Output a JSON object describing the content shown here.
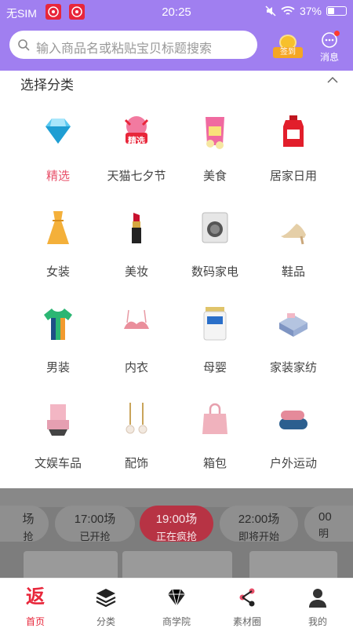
{
  "status_bar": {
    "carrier": "无SIM",
    "time": "20:25",
    "battery": "37%"
  },
  "search": {
    "placeholder": "输入商品名或粘贴宝贝标题搜索"
  },
  "header": {
    "sign_label": "签到",
    "message_label": "消息"
  },
  "panel": {
    "title": "选择分类",
    "categories": [
      {
        "label": "精选",
        "icon": "diamond-icon"
      },
      {
        "label": "天猫七夕节",
        "icon": "tmall-qixi-icon"
      },
      {
        "label": "美食",
        "icon": "snack-bag-icon"
      },
      {
        "label": "居家日用",
        "icon": "detergent-bottle-icon"
      },
      {
        "label": "女装",
        "icon": "dress-icon"
      },
      {
        "label": "美妆",
        "icon": "lipstick-icon"
      },
      {
        "label": "数码家电",
        "icon": "washing-machine-icon"
      },
      {
        "label": "鞋品",
        "icon": "heel-shoe-icon"
      },
      {
        "label": "男装",
        "icon": "tshirt-icon"
      },
      {
        "label": "内衣",
        "icon": "bra-icon"
      },
      {
        "label": "母婴",
        "icon": "milk-powder-icon"
      },
      {
        "label": "家装家纺",
        "icon": "bedding-icon"
      },
      {
        "label": "文娱车品",
        "icon": "car-seat-icon"
      },
      {
        "label": "配饰",
        "icon": "earrings-icon"
      },
      {
        "label": "箱包",
        "icon": "handbag-icon"
      },
      {
        "label": "户外运动",
        "icon": "yoga-mat-icon"
      }
    ],
    "badge_text": "精选"
  },
  "flash_sale": {
    "slots": [
      {
        "time": "场",
        "status": "抢"
      },
      {
        "time": "17:00场",
        "status": "已开抢"
      },
      {
        "time": "19:00场",
        "status": "正在疯抢"
      },
      {
        "time": "22:00场",
        "status": "即将开始"
      },
      {
        "time": "00",
        "status": "明"
      }
    ]
  },
  "tabs": [
    {
      "label": "首页",
      "icon": "fan-home-icon"
    },
    {
      "label": "分类",
      "icon": "layers-icon"
    },
    {
      "label": "商学院",
      "icon": "diamond-outline-icon"
    },
    {
      "label": "素材圈",
      "icon": "share-icon"
    },
    {
      "label": "我的",
      "icon": "user-icon"
    }
  ],
  "tab_home_glyph": "返",
  "colors": {
    "header": "#a07ff0",
    "accent": "#e8263a",
    "active_category": "#e8506a"
  }
}
